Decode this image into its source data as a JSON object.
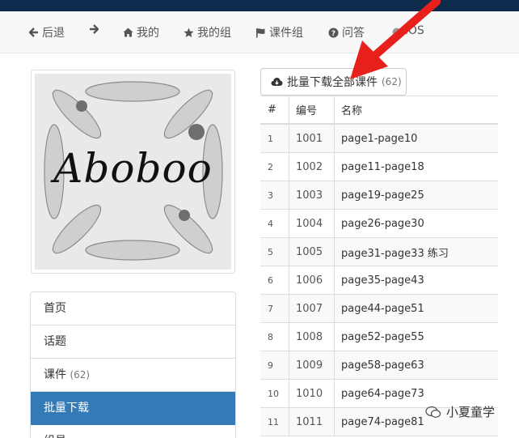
{
  "nav": {
    "back_label": "后退",
    "mine_label": "我的",
    "mygroup_label": "我的组",
    "courseware_group_label": "课件组",
    "qa_label": "问答",
    "ios_label": "iOS"
  },
  "logo": {
    "text": "Aboboo"
  },
  "sidebar": {
    "items": [
      {
        "label": "首页",
        "count": ""
      },
      {
        "label": "话题",
        "count": ""
      },
      {
        "label": "课件",
        "count": "(62)"
      },
      {
        "label": "批量下载",
        "count": ""
      },
      {
        "label": "组员",
        "count": ""
      }
    ]
  },
  "download_button": {
    "label": "批量下载全部课件",
    "count": "(62)"
  },
  "table": {
    "headers": [
      "#",
      "编号",
      "名称"
    ],
    "rows": [
      [
        "1",
        "1001",
        "page1-page10"
      ],
      [
        "2",
        "1002",
        "page11-page18"
      ],
      [
        "3",
        "1003",
        "page19-page25"
      ],
      [
        "4",
        "1004",
        "page26-page30"
      ],
      [
        "5",
        "1005",
        "page31-page33 练习"
      ],
      [
        "6",
        "1006",
        "page35-page43"
      ],
      [
        "7",
        "1007",
        "page44-page51"
      ],
      [
        "8",
        "1008",
        "page52-page55"
      ],
      [
        "9",
        "1009",
        "page58-page63"
      ],
      [
        "10",
        "1010",
        "page64-page73"
      ],
      [
        "11",
        "1011",
        "page74-page81"
      ]
    ]
  },
  "watermark": {
    "text": "小夏童学"
  },
  "colors": {
    "topbar": "#0e2a4c",
    "active": "#337ab7",
    "arrow": "#e8201c"
  }
}
